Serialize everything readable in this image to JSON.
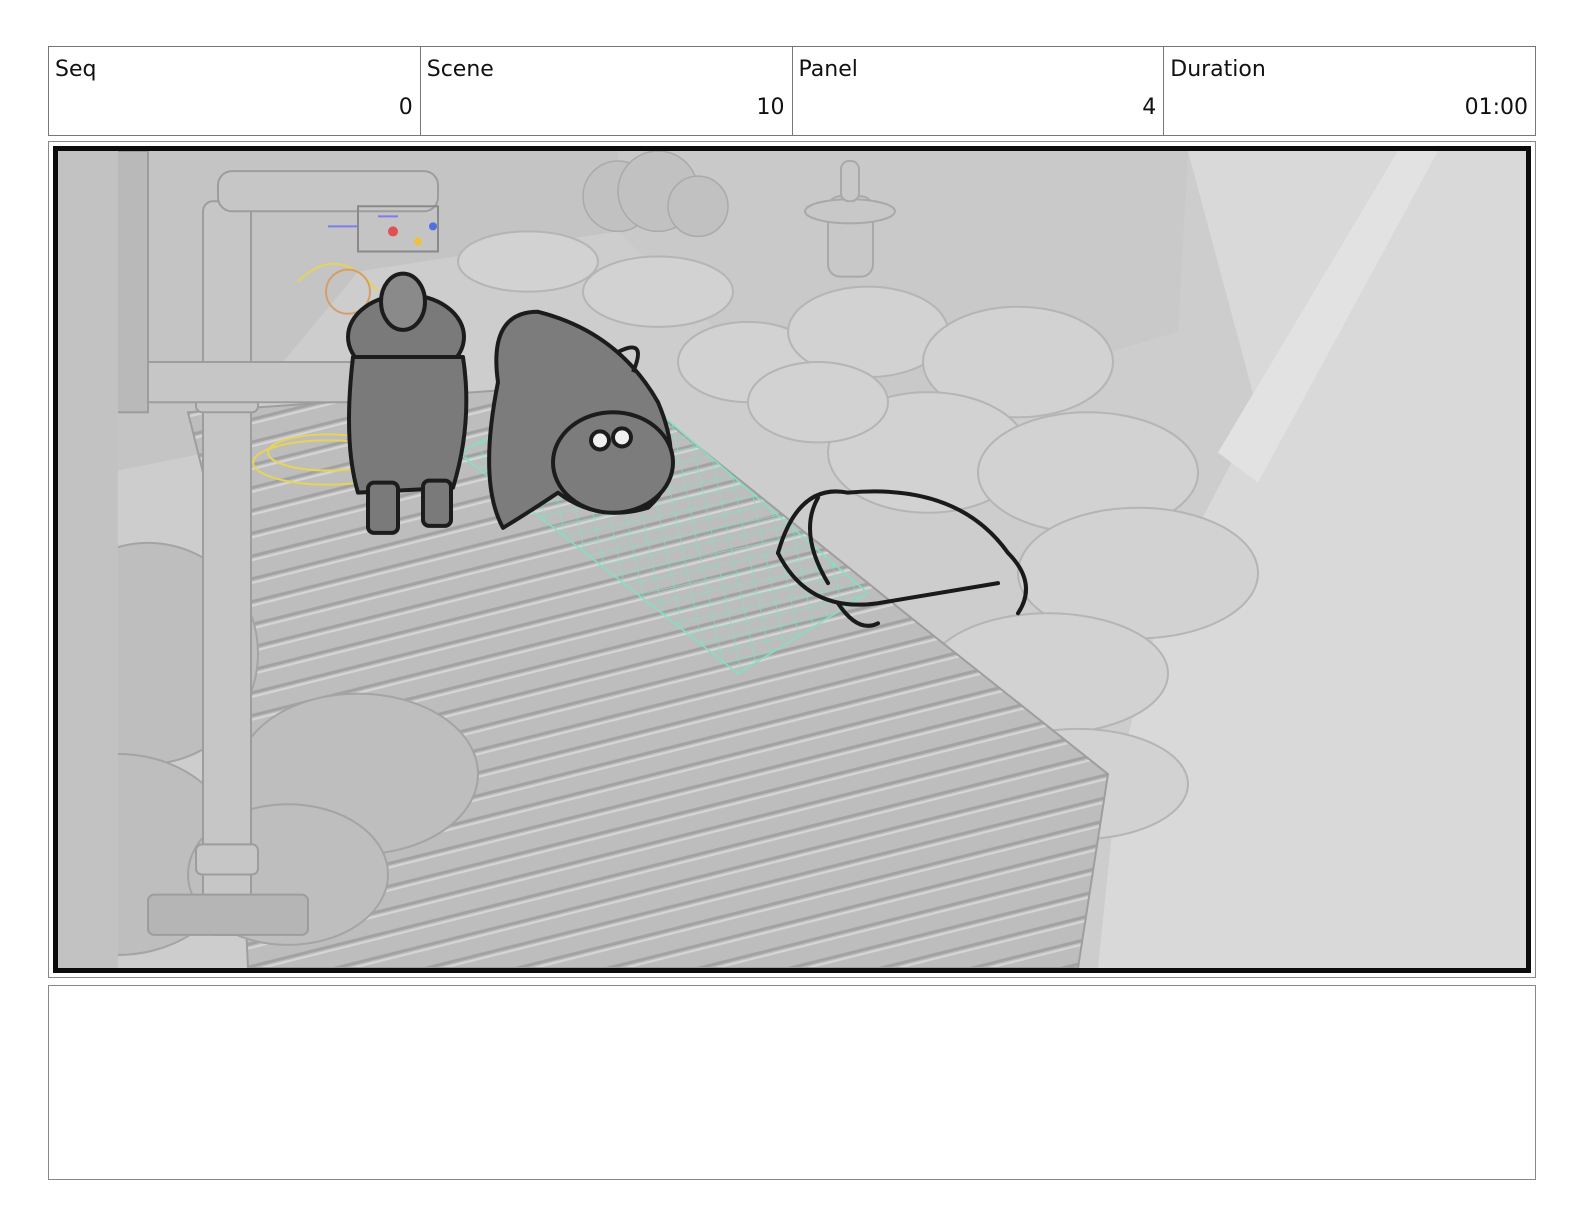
{
  "header": {
    "seq": {
      "label": "Seq",
      "value": "0"
    },
    "scene": {
      "label": "Scene",
      "value": "10"
    },
    "panel": {
      "label": "Panel",
      "value": "4"
    },
    "duration": {
      "label": "Duration",
      "value": "01:00"
    }
  },
  "notes": {
    "text": ""
  }
}
